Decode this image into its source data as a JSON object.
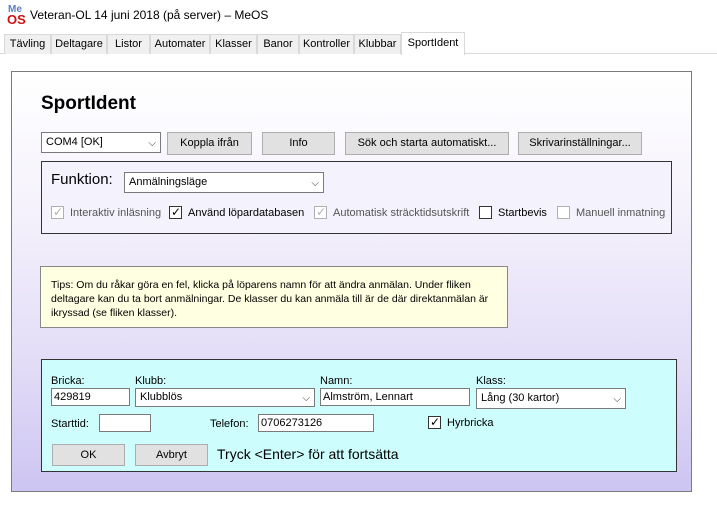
{
  "window": {
    "icon_top": "Me",
    "icon_bottom": "OS",
    "title": "Veteran-OL 14 juni 2018 (på server) – MeOS"
  },
  "tabs": [
    {
      "label": "Tävling"
    },
    {
      "label": "Deltagare"
    },
    {
      "label": "Listor"
    },
    {
      "label": "Automater"
    },
    {
      "label": "Klasser"
    },
    {
      "label": "Banor"
    },
    {
      "label": "Kontroller"
    },
    {
      "label": "Klubbar"
    },
    {
      "label": "SportIdent"
    }
  ],
  "active_tab": "SportIdent",
  "heading": "SportIdent",
  "toolbar": {
    "port_value": "COM4 [OK]",
    "disconnect": "Koppla ifrån",
    "info": "Info",
    "autosearch": "Sök och starta automatiskt...",
    "printer": "Skrivarinställningar..."
  },
  "function": {
    "label": "Funktion:",
    "value": "Anmälningsläge",
    "options": [
      {
        "label": "Interaktiv inläsning",
        "checked": true,
        "enabled": false
      },
      {
        "label": "Använd löpardatabasen",
        "checked": true,
        "enabled": true
      },
      {
        "label": "Automatisk sträcktidsutskrift",
        "checked": true,
        "enabled": false
      },
      {
        "label": "Startbevis",
        "checked": false,
        "enabled": true
      },
      {
        "label": "Manuell inmatning",
        "checked": false,
        "enabled": false
      }
    ]
  },
  "tip": "Tips: Om du råkar göra en fel, klicka på löparens namn för att ändra anmälan. Under fliken deltagare kan du ta bort anmälningar. De klasser du kan anmäla till är de där direktanmälan är ikryssad (se fliken klasser).",
  "form": {
    "card_label": "Bricka:",
    "card_value": "429819",
    "club_label": "Klubb:",
    "club_value": "Klubblös",
    "name_label": "Namn:",
    "name_value": "Almström, Lennart",
    "class_label": "Klass:",
    "class_value": "Lång (30 kartor)",
    "start_label": "Starttid:",
    "start_value": "",
    "phone_label": "Telefon:",
    "phone_value": "0706273126",
    "rental_label": "Hyrbricka",
    "rental_checked": true,
    "ok": "OK",
    "cancel": "Avbryt",
    "hint": "Tryck <Enter> för att fortsätta"
  }
}
